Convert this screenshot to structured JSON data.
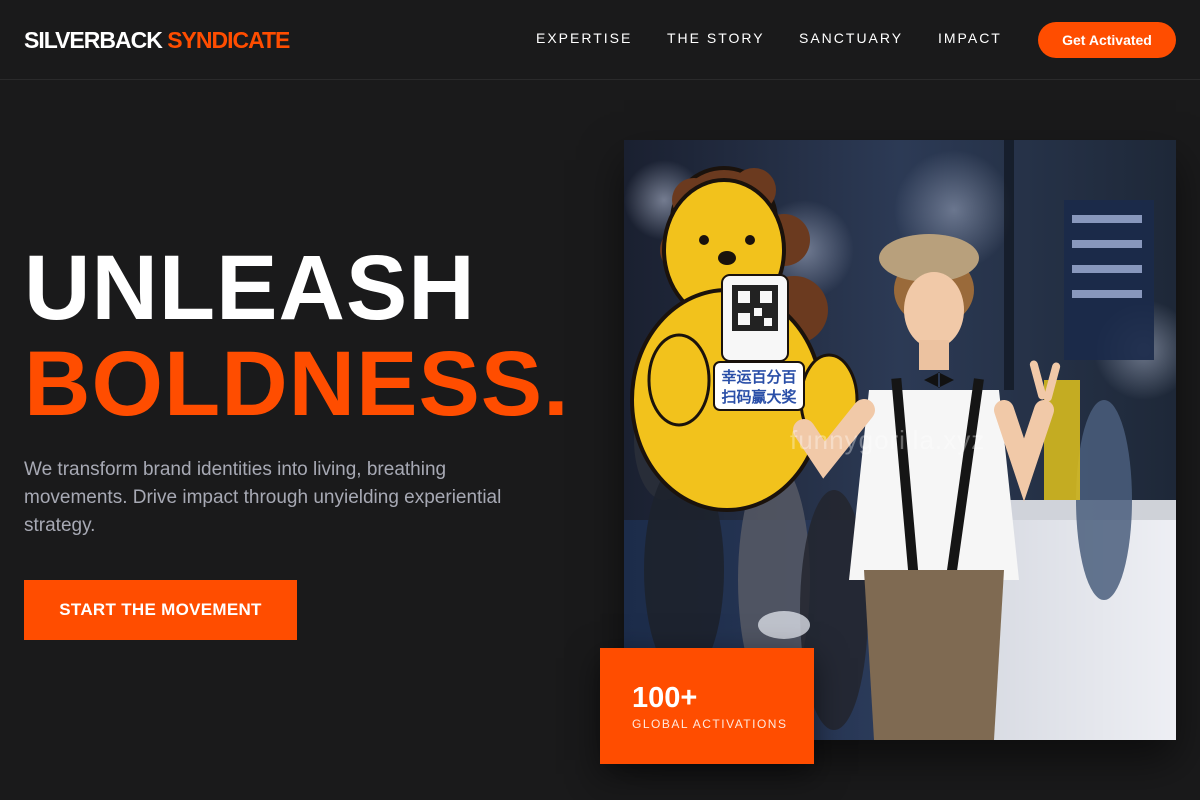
{
  "header": {
    "logo_part1": "SILVERBACK",
    "logo_part2": "SYNDICATE",
    "nav": [
      "EXPERTISE",
      "THE STORY",
      "SANCTUARY",
      "IMPACT"
    ],
    "cta_label": "Get Activated"
  },
  "hero": {
    "headline_line1": "UNLEASH",
    "headline_line2": "BOLDNESS.",
    "subtitle": "We transform brand identities into living, breathing movements. Drive impact through unyielding experiential strategy.",
    "cta_label": "START THE MOVEMENT"
  },
  "image": {
    "watermark": "funnygorilla.xyz",
    "sign_text_line1": "幸运百分百",
    "sign_text_line2": "扫码赢大奖"
  },
  "stat": {
    "value": "100+",
    "label": "GLOBAL ACTIVATIONS"
  },
  "colors": {
    "accent": "#ff4d00",
    "background": "#1a1a1b",
    "muted_text": "#a7a9b4"
  }
}
